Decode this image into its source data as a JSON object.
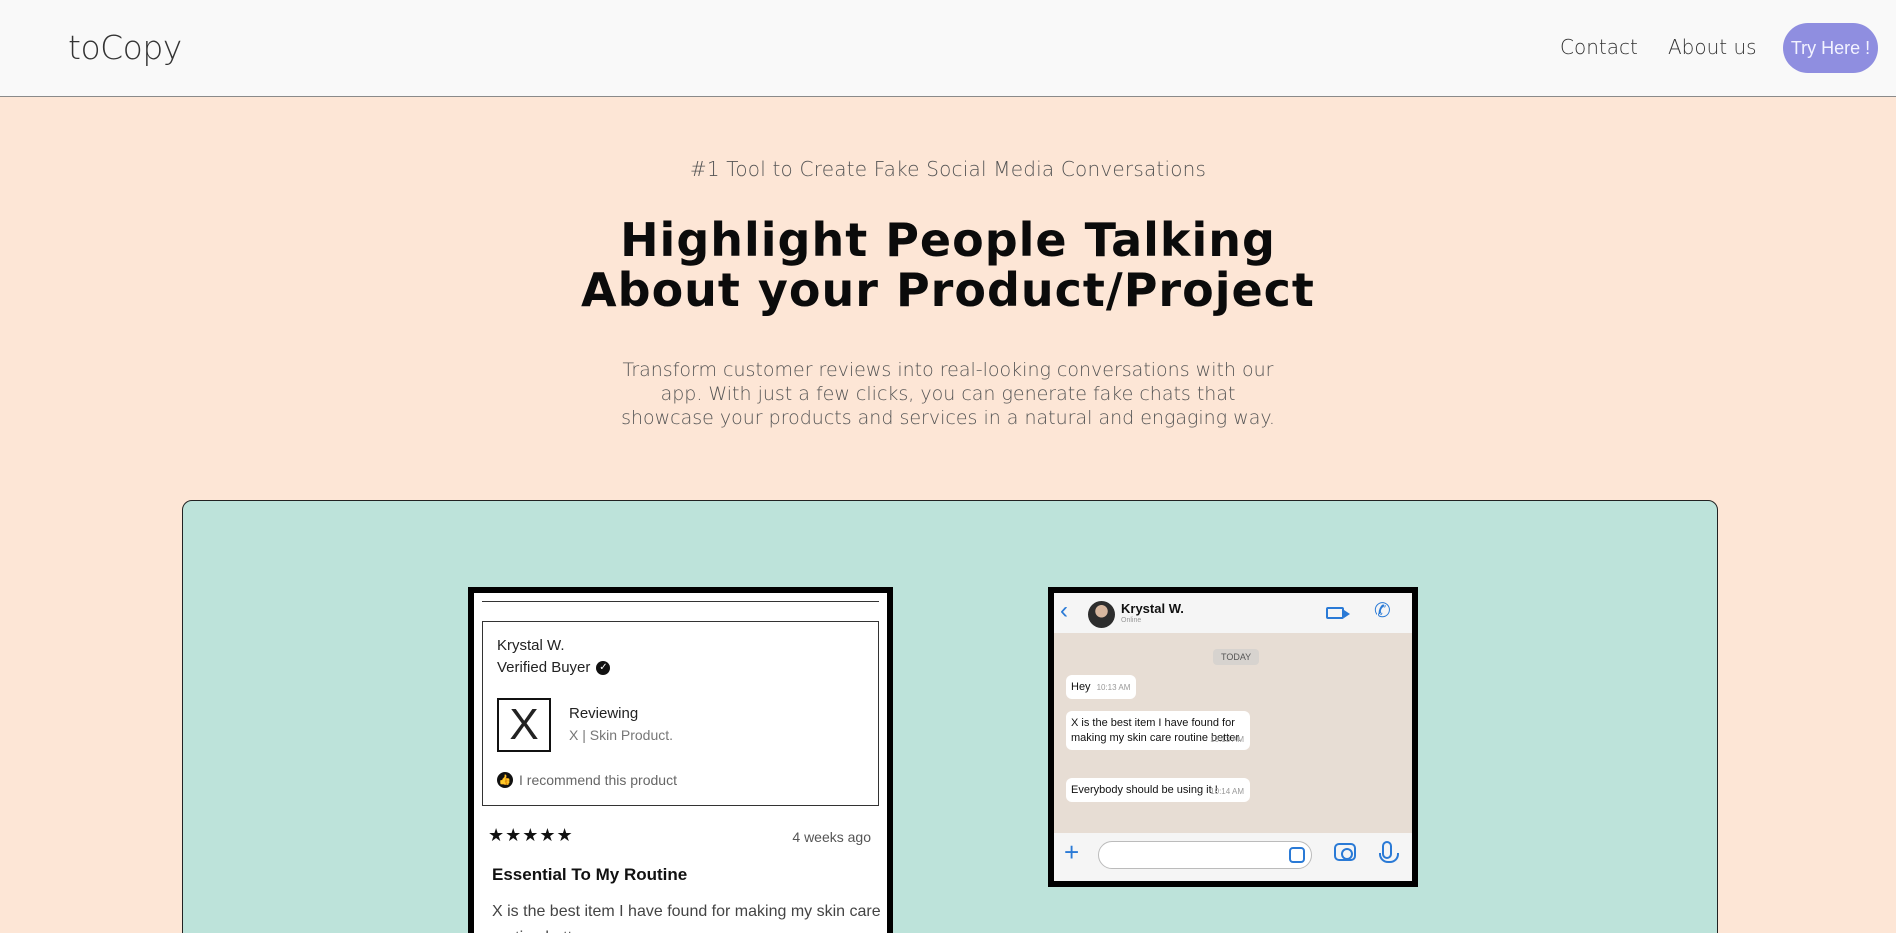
{
  "header": {
    "logo": "toCopy",
    "nav": {
      "contact": "Contact",
      "about": "About us"
    },
    "cta": "Try Here !",
    "cta_color": "#8f8ee0"
  },
  "hero": {
    "eyebrow": "#1 Tool to Create Fake Social Media Conversations",
    "headline_line1": "Highlight People Talking",
    "headline_line2": "About your Product/Project",
    "subtext": "Transform customer reviews into real-looking conversations with our app. With just a few clicks, you can generate fake chats that showcase your products and services in a natural and engaging way.",
    "background": "#fde6d6"
  },
  "showcase": {
    "background": "#bde3da",
    "review": {
      "reviewer": "Krystal W.",
      "verified": "Verified Buyer",
      "product_logo": "X",
      "reviewing": "Reviewing",
      "product": "X | Skin Product.",
      "recommend": "I recommend this product",
      "rating": 5,
      "stars": "★★★★★",
      "when": "4 weeks ago",
      "title": "Essential To My Routine",
      "body": "X is the best item I have found for making my skin care routine better."
    },
    "chat": {
      "contact": "Krystal W.",
      "status": "Online",
      "date_label": "TODAY",
      "messages": [
        {
          "text": "Hey",
          "time": "10:13 AM"
        },
        {
          "text": "X is the best item I have found for making my skin care routine better.",
          "time": "10:13 AM"
        },
        {
          "text": "Everybody should be using it !",
          "time": "10:14 AM"
        }
      ],
      "accent_color": "#2a7ad6"
    }
  }
}
